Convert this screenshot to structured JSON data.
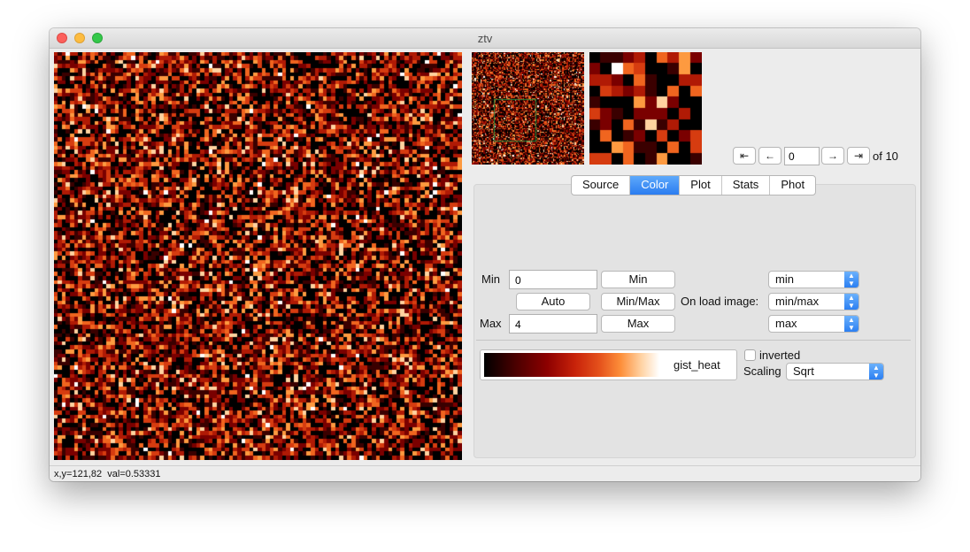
{
  "window": {
    "title": "ztv"
  },
  "navigation": {
    "first_icon": "⇤",
    "prev_icon": "←",
    "frame_value": "0",
    "next_icon": "→",
    "last_icon": "⇥",
    "of_label": "of 10"
  },
  "tabs": [
    {
      "label": "Source",
      "active": false
    },
    {
      "label": "Color",
      "active": true
    },
    {
      "label": "Plot",
      "active": false
    },
    {
      "label": "Stats",
      "active": false
    },
    {
      "label": "Phot",
      "active": false
    }
  ],
  "color_tab": {
    "min_label": "Min",
    "min_value": "0",
    "min_button": "Min",
    "auto_button": "Auto",
    "minmax_button": "Min/Max",
    "max_label": "Max",
    "max_value": "4",
    "max_button": "Max",
    "on_load_label": "On load image:",
    "on_load_min": "min",
    "on_load_minmax": "min/max",
    "on_load_max": "max",
    "colormap_name": "gist_heat",
    "inverted_label": "inverted",
    "inverted_checked": false,
    "scaling_label": "Scaling",
    "scaling_value": "Sqrt"
  },
  "colormap_colors": [
    "#000000",
    "#3a0000",
    "#7a0000",
    "#b01a05",
    "#d63c10",
    "#f0651f",
    "#fd9a40",
    "#ffd3a0",
    "#ffffff"
  ],
  "zoom_box_color": "#2e8b3d",
  "statusbar": {
    "text": "x,y=121,82  val=0.53331"
  }
}
